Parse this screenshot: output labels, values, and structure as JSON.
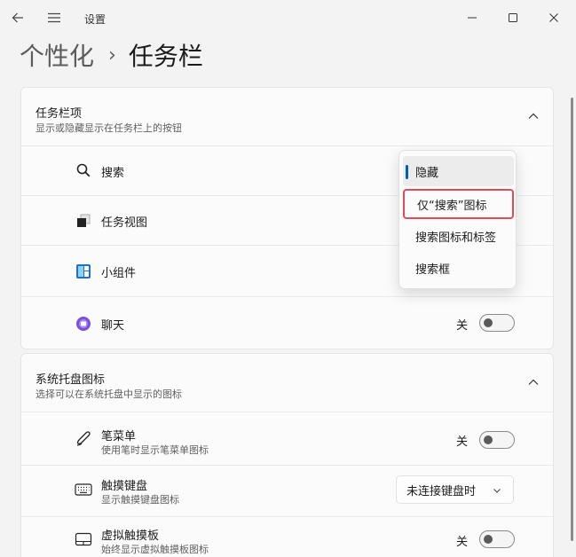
{
  "window": {
    "title": "设置",
    "back_icon": "back-arrow-icon",
    "menu_icon": "hamburger-menu-icon"
  },
  "breadcrumb": {
    "parent": "个性化",
    "separator": "›",
    "current": "任务栏"
  },
  "taskbar_items": {
    "title": "任务栏项",
    "subtitle": "显示或隐藏显示在任务栏上的按钮",
    "rows": [
      {
        "label": "搜索",
        "icon": "search-icon"
      },
      {
        "label": "任务视图",
        "icon": "task-view-icon"
      },
      {
        "label": "小组件",
        "icon": "widgets-icon"
      },
      {
        "label": "聊天",
        "icon": "chat-icon",
        "toggle_label": "关",
        "toggle_on": false
      }
    ]
  },
  "search_dropdown": {
    "options": [
      "隐藏",
      "仅“搜索”图标",
      "搜索图标和标签",
      "搜索框"
    ],
    "selected_index": 0,
    "highlighted_index": 1
  },
  "tray_icons": {
    "title": "系统托盘图标",
    "subtitle": "选择可以在系统托盘中显示的图标",
    "rows": [
      {
        "label": "笔菜单",
        "sublabel": "使用笔时显示笔菜单图标",
        "icon": "pen-icon",
        "toggle_label": "关",
        "toggle_on": false
      },
      {
        "label": "触摸键盘",
        "sublabel": "显示触摸键盘图标",
        "icon": "keyboard-icon",
        "select_value": "未连接键盘时"
      },
      {
        "label": "虚拟触摸板",
        "sublabel": "始终显示虚拟触摸板图标",
        "icon": "touchpad-icon",
        "toggle_label": "关",
        "toggle_on": false
      }
    ]
  },
  "colors": {
    "accent": "#005fb8",
    "highlight_border": "#e24c5a"
  }
}
